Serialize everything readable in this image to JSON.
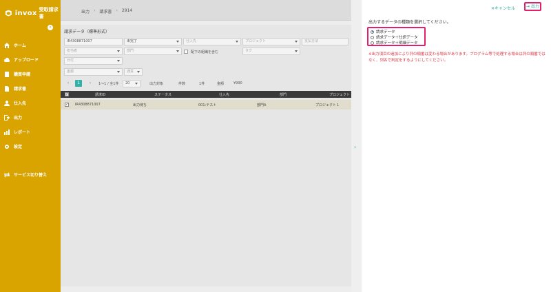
{
  "app": {
    "brand": "invox",
    "product": "受取請求書"
  },
  "sidebar": {
    "collapse_icon": "chevron-left-icon",
    "items": [
      {
        "label": "ホーム",
        "icon": "home-icon"
      },
      {
        "label": "アップロード",
        "icon": "cloud-upload-icon"
      },
      {
        "label": "購買申請",
        "icon": "document-icon"
      },
      {
        "label": "請求書",
        "icon": "file-icon"
      },
      {
        "label": "仕入先",
        "icon": "person-icon"
      },
      {
        "label": "出力",
        "icon": "export-icon"
      },
      {
        "label": "レポート",
        "icon": "chart-icon"
      },
      {
        "label": "設定",
        "icon": "gear-icon"
      },
      {
        "label": "サービス切り替え",
        "icon": "switch-icon"
      }
    ]
  },
  "breadcrumb": {
    "items": [
      "出力",
      "請求書",
      "2914"
    ],
    "sep": "›"
  },
  "card": {
    "title": "請求データ（標準形式）",
    "filters": {
      "invoice_no": "IR4308871007",
      "status": "未完了",
      "supplier": "仕入先",
      "project": "プロジェクト",
      "payment": "支払方法",
      "person": "担当者",
      "dept": "部門",
      "sub_org_label": "配下の組織を含む",
      "tag": "タグ",
      "date": "日付",
      "amount": "金額",
      "currency": "通貨"
    },
    "pagination": {
      "prev": "‹",
      "page": "1",
      "next": "›",
      "range": "1〜1 / 全1件",
      "per_page": "20"
    },
    "summary": {
      "target_label": "出力対象",
      "count_label": "件数",
      "count_value": "1件",
      "amount_label": "金額",
      "amount_value": "¥990"
    },
    "table": {
      "headers": [
        "請求ID",
        "ステータス",
        "仕入先",
        "部門",
        "プロジェクト"
      ],
      "rows": [
        {
          "id": "IR4308871007",
          "status": "出力待ち",
          "supplier": "001:テスト",
          "dept": "部門A",
          "project": "プロジェクト１"
        }
      ]
    }
  },
  "panel": {
    "expand_icon": "chevron-right-icon",
    "cancel_label": "キャンセル",
    "output_label": "出力",
    "instruction": "出力するデータの種類を選択してください。",
    "options": [
      {
        "label": "請求データ",
        "selected": true
      },
      {
        "label": "請求データ＋仕訳データ",
        "selected": false
      },
      {
        "label": "請求データ＋明細データ",
        "selected": false
      }
    ],
    "note": "※出力項目の追加により列の順番は変わる場合があります。プログラム等で処理する場合は列の順番ではなく、列名で判定をするようにしてください。"
  },
  "colors": {
    "sidebar": "#d9a400",
    "accent": "#2fa6a0",
    "highlight": "#e0206a",
    "note": "#d9343f"
  }
}
